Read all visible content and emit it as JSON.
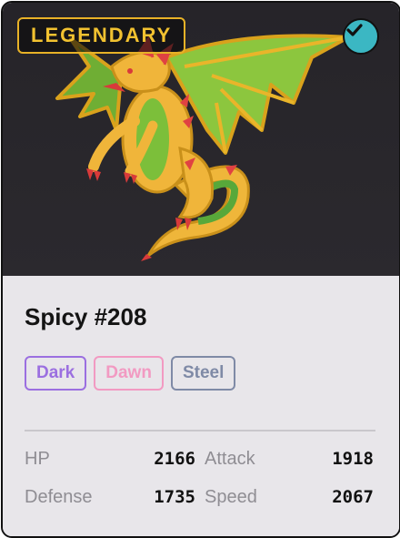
{
  "card": {
    "rarity": "LEGENDARY",
    "verified_icon": "check-circle-icon",
    "title": "Spicy #208",
    "tags": [
      {
        "label": "Dark",
        "color": "#9b6fe0"
      },
      {
        "label": "Dawn",
        "color": "#f29ac2"
      },
      {
        "label": "Steel",
        "color": "#7f8aa6"
      }
    ],
    "stats": [
      [
        {
          "label": "HP",
          "value": "2166"
        },
        {
          "label": "Attack",
          "value": "1918"
        }
      ],
      [
        {
          "label": "Defense",
          "value": "1735"
        },
        {
          "label": "Speed",
          "value": "2067"
        }
      ]
    ]
  },
  "colors": {
    "badge_gold": "#f2c230",
    "verified_teal": "#3bb7c3",
    "hero_bg": "#262429",
    "card_bg": "#e8e6ea"
  }
}
